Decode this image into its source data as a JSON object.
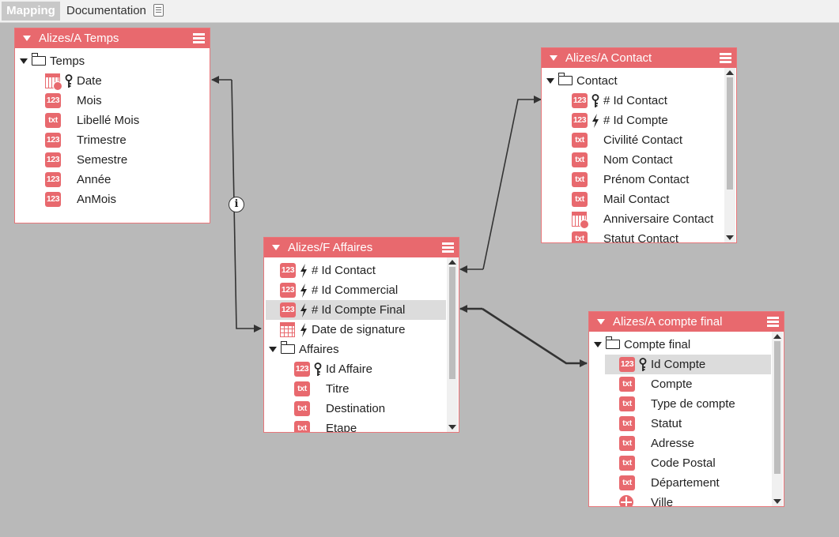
{
  "tabs": {
    "mapping": "Mapping",
    "documentation": "Documentation"
  },
  "info_symbol": "i",
  "tables": {
    "temps": {
      "title": "Alizes/A Temps",
      "folder": "Temps",
      "rows": [
        {
          "icon": "calendar-clock-icon",
          "key": true,
          "label": "Date"
        },
        {
          "icon": "number-icon",
          "badge": "123",
          "label": "Mois"
        },
        {
          "icon": "text-icon",
          "badge": "txt",
          "label": "Libellé Mois"
        },
        {
          "icon": "number-icon",
          "badge": "123",
          "label": "Trimestre"
        },
        {
          "icon": "number-icon",
          "badge": "123",
          "label": "Semestre"
        },
        {
          "icon": "number-icon",
          "badge": "123",
          "label": "Année"
        },
        {
          "icon": "number-icon",
          "badge": "123",
          "label": "AnMois"
        }
      ]
    },
    "contact": {
      "title": "Alizes/A Contact",
      "folder": "Contact",
      "rows": [
        {
          "icon": "number-icon",
          "badge": "123",
          "key": true,
          "label": "# Id Contact"
        },
        {
          "icon": "number-icon",
          "badge": "123",
          "link": true,
          "label": "# Id Compte"
        },
        {
          "icon": "text-icon",
          "badge": "txt",
          "label": "Civilité Contact"
        },
        {
          "icon": "text-icon",
          "badge": "txt",
          "label": "Nom Contact"
        },
        {
          "icon": "text-icon",
          "badge": "txt",
          "label": "Prénom Contact"
        },
        {
          "icon": "text-icon",
          "badge": "txt",
          "label": "Mail Contact"
        },
        {
          "icon": "calendar-clock-icon",
          "label": "Anniversaire Contact"
        },
        {
          "icon": "text-icon",
          "badge": "txt",
          "label": "Statut Contact"
        }
      ]
    },
    "affaires": {
      "title": "Alizes/F Affaires",
      "top_rows": [
        {
          "icon": "number-icon",
          "badge": "123",
          "link": true,
          "label": "# Id Contact"
        },
        {
          "icon": "number-icon",
          "badge": "123",
          "link": true,
          "label": "# Id Commercial"
        },
        {
          "icon": "number-icon",
          "badge": "123",
          "link": true,
          "label": "# Id Compte Final",
          "selected": true
        },
        {
          "icon": "calendar-icon",
          "link": true,
          "label": "Date de signature"
        }
      ],
      "folder": "Affaires",
      "rows": [
        {
          "icon": "number-icon",
          "badge": "123",
          "key": true,
          "label": "Id Affaire"
        },
        {
          "icon": "text-icon",
          "badge": "txt",
          "label": "Titre"
        },
        {
          "icon": "text-icon",
          "badge": "txt",
          "label": "Destination"
        },
        {
          "icon": "text-icon",
          "badge": "txt",
          "label": "Etape"
        }
      ]
    },
    "compte": {
      "title": "Alizes/A compte final",
      "folder": "Compte final",
      "rows": [
        {
          "icon": "number-icon",
          "badge": "123",
          "key": true,
          "label": "Id Compte",
          "selected": true
        },
        {
          "icon": "text-icon",
          "badge": "txt",
          "label": "Compte"
        },
        {
          "icon": "text-icon",
          "badge": "txt",
          "label": "Type de compte"
        },
        {
          "icon": "text-icon",
          "badge": "txt",
          "label": "Statut"
        },
        {
          "icon": "text-icon",
          "badge": "txt",
          "label": "Adresse"
        },
        {
          "icon": "text-icon",
          "badge": "txt",
          "label": "Code Postal"
        },
        {
          "icon": "text-icon",
          "badge": "txt",
          "label": "Département"
        },
        {
          "icon": "globe-icon",
          "label": "Ville"
        }
      ]
    }
  },
  "colors": {
    "accent": "#e8696e",
    "canvas": "#b9b9b9",
    "selected_row": "#dcdcdc"
  }
}
